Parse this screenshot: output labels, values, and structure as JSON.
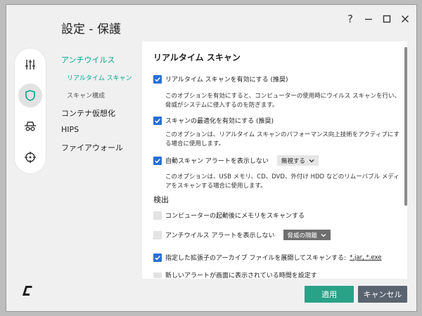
{
  "window": {
    "title": "設定 - 保護",
    "controls": {
      "help": "?",
      "minimize": "–",
      "maximize": "☐",
      "close": "✕"
    }
  },
  "rail": {
    "items": [
      {
        "name": "settings-sliders-icon",
        "active": false
      },
      {
        "name": "shield-icon",
        "active": true
      },
      {
        "name": "spy-icon",
        "active": false
      },
      {
        "name": "crosshair-icon",
        "active": false
      }
    ]
  },
  "nav": {
    "antivirus": "アンチウイルス",
    "realtime_scan": "リアルタイム スキャン",
    "scan_config": "スキャン構成",
    "containment": "コンテナ仮想化",
    "hips": "HIPS",
    "firewall": "ファイアウォール"
  },
  "panel": {
    "title": "リアルタイム スキャン",
    "opt1": {
      "label": "リアルタイム スキャンを有効にする (推奨)",
      "checked": true,
      "desc": "このオプションを有効にすると、コンピューターの使用時にウイルス スキャンを行い、脅威がシステムに侵入するのを防ぎます。"
    },
    "opt2": {
      "label": "スキャンの最適化を有効にする (推奨)",
      "checked": true,
      "desc": "このオプションは、リアルタイム スキャンのパフォーマンス向上技術をアクティブにする場合に使用します。"
    },
    "opt3": {
      "label": "自動スキャン アラートを表示しない",
      "checked": true,
      "dropdown": "無視する",
      "desc": "このオプションは、USB メモリ、CD、DVD、外付け HDD などのリムーバブル メディアをスキャンする場合に使用します。"
    },
    "detection_heading": "検出",
    "opt4": {
      "label": "コンピューターの起動後にメモリをスキャンする",
      "checked": false
    },
    "opt5": {
      "label": "アンチウイルス アラートを表示しない",
      "checked": false,
      "dropdown": "脅威の隔離"
    },
    "opt6": {
      "label": "指定した拡張子のアーカイブ ファイルを展開してスキャンする:",
      "checked": true,
      "extensions": "*.jar, *.exe"
    },
    "opt7": {
      "label": "新しいアラートが画面に表示されている時間を設定す"
    }
  },
  "buttons": {
    "apply": "適用",
    "cancel": "キャンセル"
  },
  "colors": {
    "accent": "#2aa288",
    "checkbox": "#2a6fd6",
    "cancel": "#5a6470"
  }
}
